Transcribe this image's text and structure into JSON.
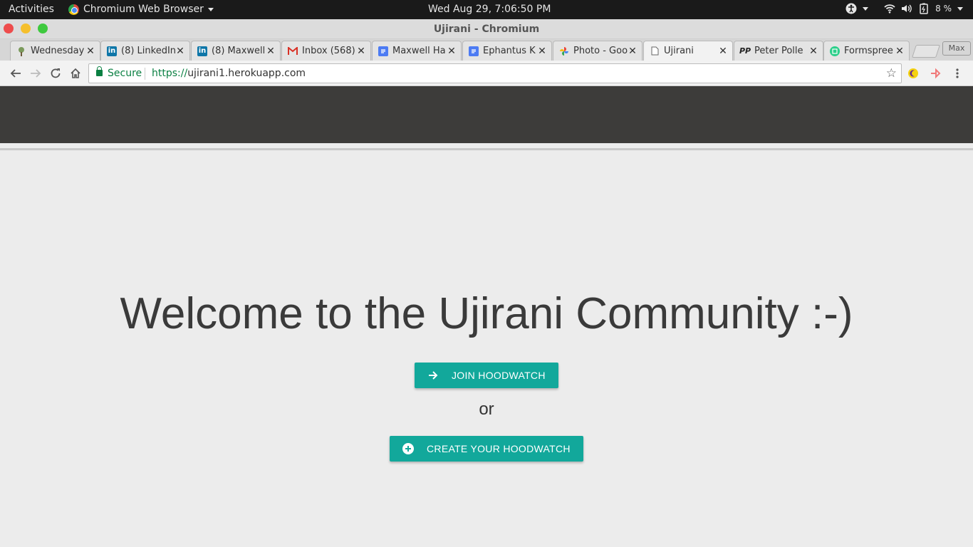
{
  "system_bar": {
    "activities": "Activities",
    "app_name": "Chromium Web Browser",
    "clock": "Wed Aug 29,  7:06:50 PM",
    "battery": "8 %"
  },
  "window": {
    "title": "Ujirani - Chromium"
  },
  "tabs": [
    {
      "label": "Wednesday",
      "icon": "tree-icon"
    },
    {
      "label": "(8) LinkedIn",
      "icon": "linkedin-icon"
    },
    {
      "label": "(8) Maxwell",
      "icon": "linkedin-icon"
    },
    {
      "label": "Inbox (568)",
      "icon": "gmail-icon"
    },
    {
      "label": "Maxwell Ha",
      "icon": "docs-icon"
    },
    {
      "label": "Ephantus K",
      "icon": "docs-icon"
    },
    {
      "label": "Photo - Goo",
      "icon": "photos-icon"
    },
    {
      "label": "Ujirani",
      "icon": "page-icon"
    },
    {
      "label": "Peter Polle",
      "icon": "pp-icon"
    },
    {
      "label": "Formspree",
      "icon": "formspree-icon"
    }
  ],
  "max_button": "Max",
  "address_bar": {
    "secure_label": "Secure",
    "scheme": "https://",
    "host": "ujirani1.herokuapp.com"
  },
  "page": {
    "heading": "Welcome to the Ujirani Community :-)",
    "join_button": "JOIN HOODWATCH",
    "or_text": "or",
    "create_button": "CREATE YOUR HOODWATCH"
  },
  "colors": {
    "accent": "#12a89b",
    "header_bg": "#3d3c3a",
    "page_bg": "#ececec"
  }
}
